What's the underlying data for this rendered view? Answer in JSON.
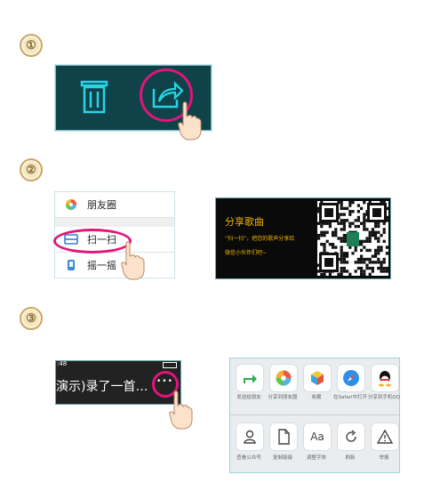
{
  "steps": [
    "①",
    "②",
    "③"
  ],
  "step2": {
    "menu": [
      {
        "label": "朋友圈",
        "icon": "moments-icon"
      },
      {
        "label": "扫一扫",
        "icon": "scan-icon"
      },
      {
        "label": "摇一摇",
        "icon": "shake-icon"
      }
    ],
    "card": {
      "title": "分享歌曲",
      "line1": "“扫一扫”，把您的歌声分享给",
      "line2": "微信小伙伴们吧~"
    }
  },
  "step3": {
    "status_time": ":48",
    "title": "演示)录了一首…",
    "more": "•••",
    "share_items": [
      {
        "label": "发送给朋友",
        "icon": "send-friend-icon"
      },
      {
        "label": "分享到朋友圈",
        "icon": "moments-icon"
      },
      {
        "label": "收藏",
        "icon": "favorite-icon"
      },
      {
        "label": "在Safari中打开",
        "icon": "safari-icon"
      },
      {
        "label": "分享到手机QQ",
        "icon": "qq-icon"
      }
    ],
    "action_items": [
      {
        "label": "查看公众号",
        "icon": "profile-icon"
      },
      {
        "label": "复制链接",
        "icon": "copy-link-icon"
      },
      {
        "label": "调整字体",
        "icon": "font-icon",
        "glyph": "Aa"
      },
      {
        "label": "刷新",
        "icon": "refresh-icon"
      },
      {
        "label": "举报",
        "icon": "report-icon"
      }
    ]
  },
  "colors": {
    "accent": "#e0157a",
    "teal": "#0f3f45",
    "neon": "#27d4e6",
    "gold": "#f0b400"
  }
}
